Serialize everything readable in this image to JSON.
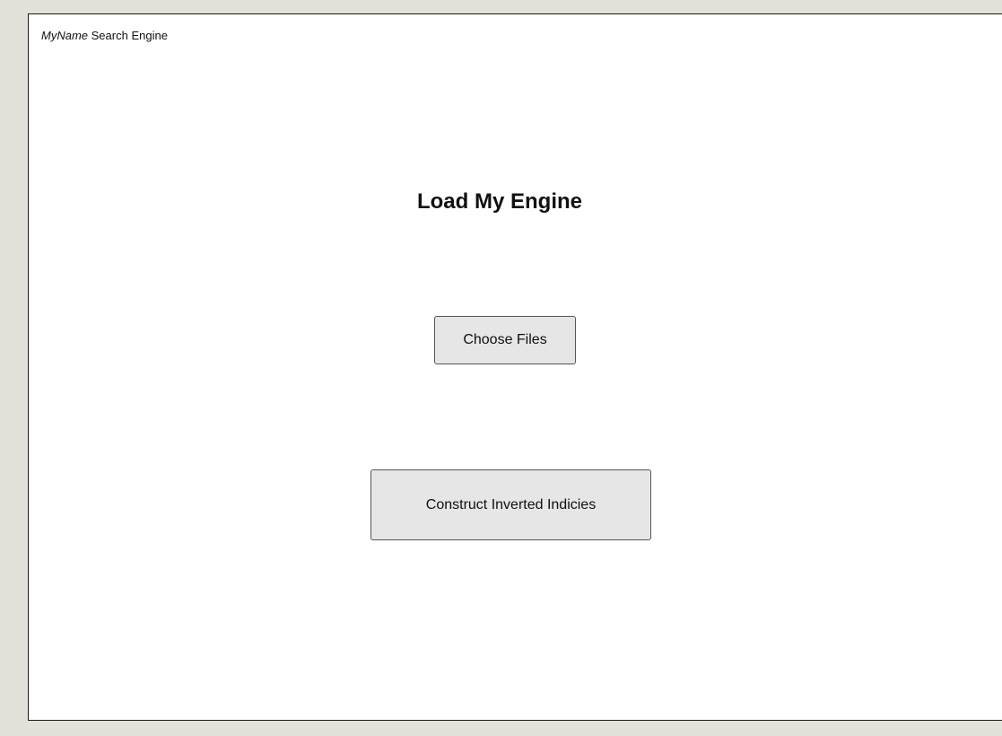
{
  "header": {
    "brand": "MyName",
    "title": "Search Engine"
  },
  "main": {
    "heading": "Load My Engine",
    "choose_files_label": "Choose Files",
    "construct_label": "Construct Inverted Indicies"
  }
}
